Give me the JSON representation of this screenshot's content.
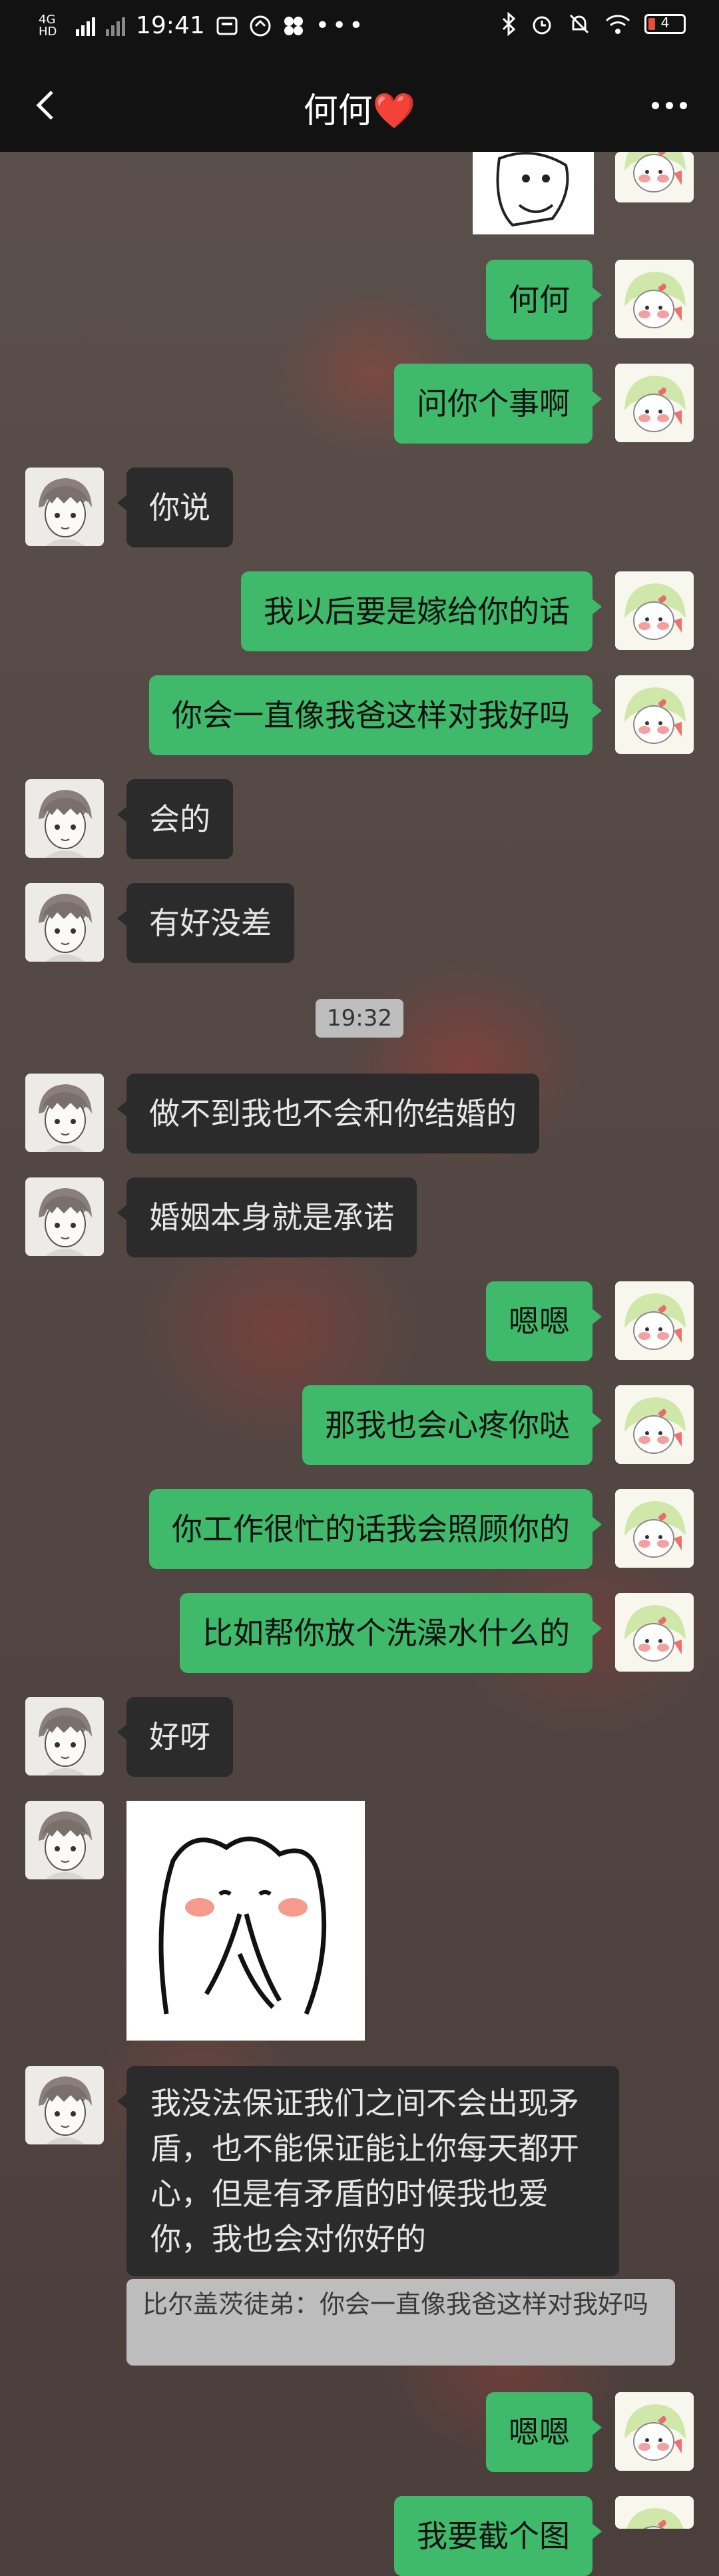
{
  "status_bar": {
    "network": "4G HD",
    "time": "19:41",
    "battery": "4"
  },
  "header": {
    "title": "何何❤️"
  },
  "messages": {
    "m1": "何何",
    "m2": "问你个事啊",
    "m3": "你说",
    "m4": "我以后要是嫁给你的话",
    "m5": "你会一直像我爸这样对我好吗",
    "m6": "会的",
    "m7": "有好没差",
    "timestamp": "19:32",
    "m8": "做不到我也不会和你结婚的",
    "m9": "婚姻本身就是承诺",
    "m10": "嗯嗯",
    "m11": "那我也会心疼你哒",
    "m12": "你工作很忙的话我会照顾你的",
    "m13": "比如帮你放个洗澡水什么的",
    "m14": "好呀",
    "m15": "我没法保证我们之间不会出现矛盾，也不能保证能让你每天都开心，但是有矛盾的时候我也爱你，我也会对你好的",
    "quote": "比尔盖茨徒弟：你会一直像我爸这样对我好吗",
    "m16": "嗯嗯",
    "m17": "我要截个图"
  },
  "colors": {
    "my_bubble": "#3fba6a",
    "other_bubble": "#2b2b2b",
    "bar": "#121212"
  },
  "icons": [
    "back-icon",
    "more-icon",
    "bluetooth-icon",
    "alarm-icon",
    "mute-icon",
    "wifi-icon",
    "battery-icon"
  ]
}
